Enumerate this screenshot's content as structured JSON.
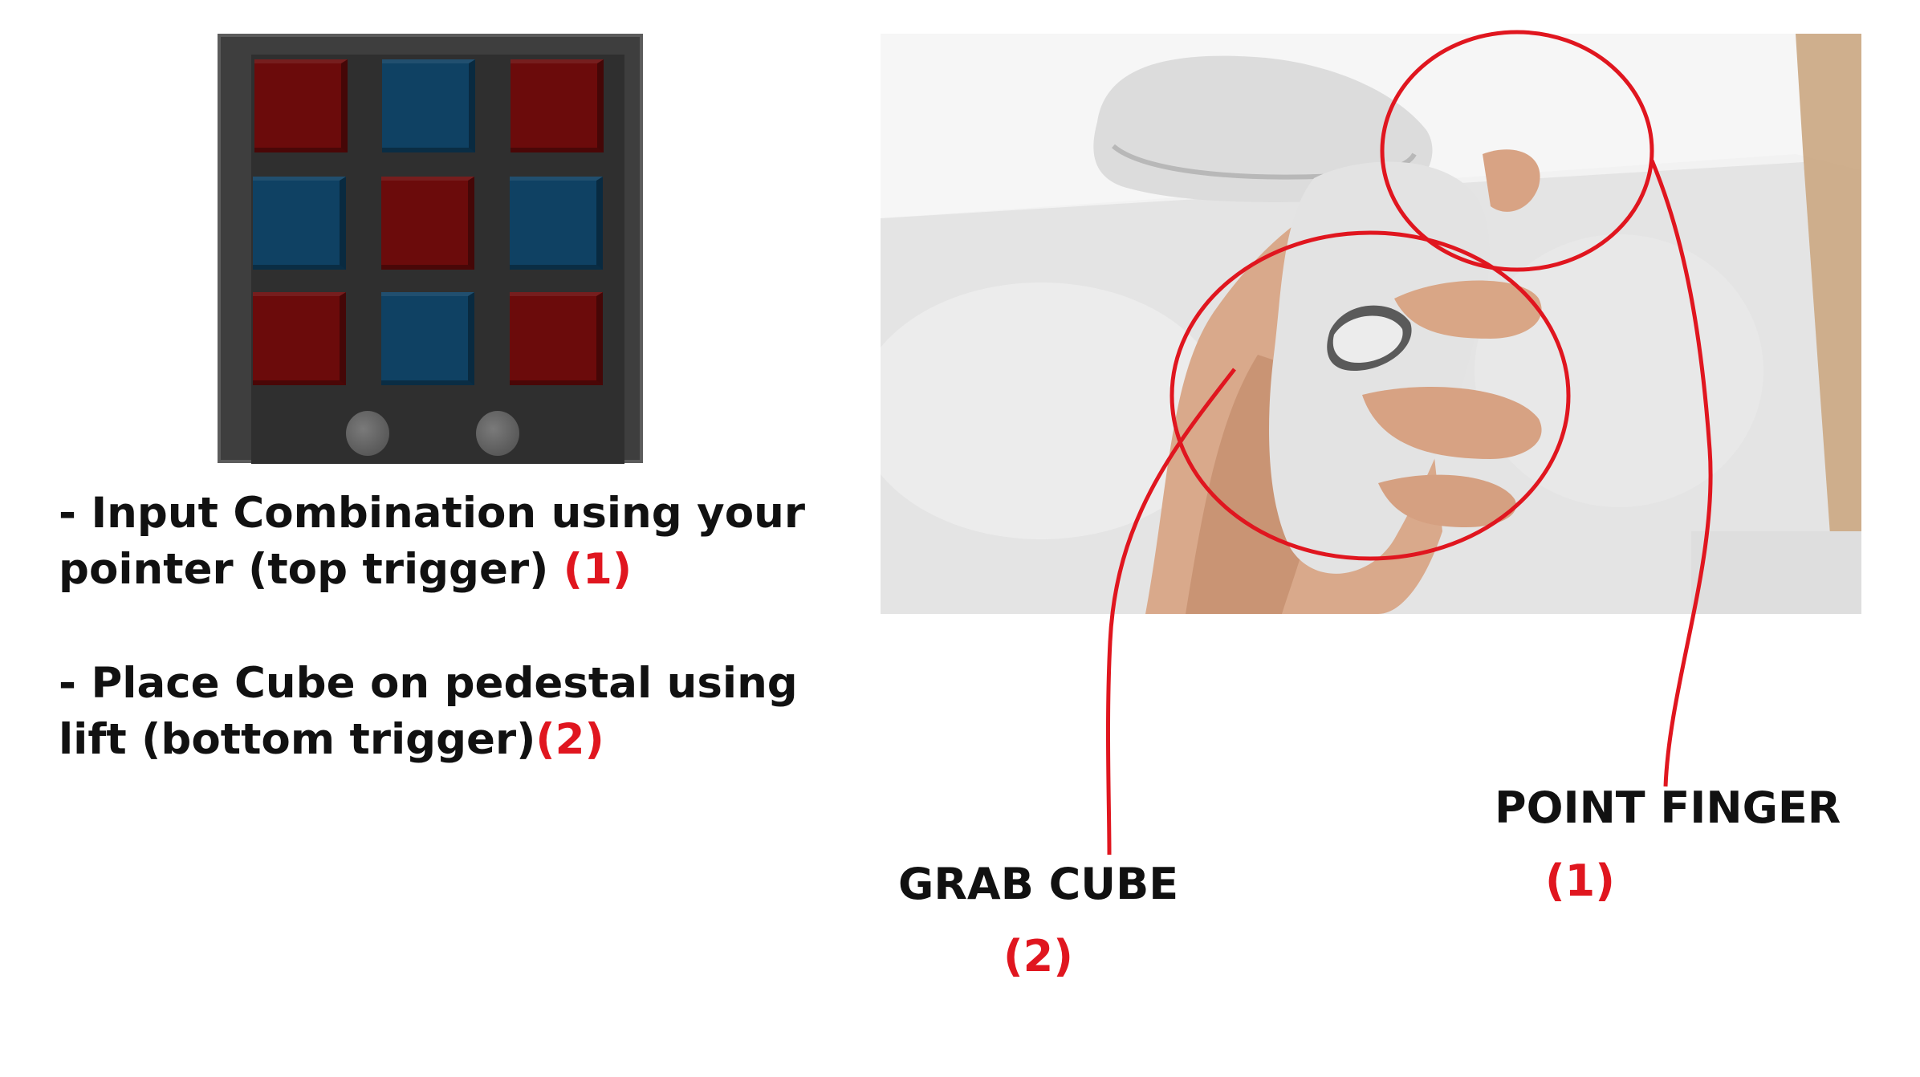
{
  "instructions": [
    {
      "line1": "- Input Combination using your",
      "line2": "pointer (top trigger) ",
      "marker": "(1)"
    },
    {
      "line1": "- Place Cube on pedestal using",
      "line2": "lift (bottom trigger)",
      "marker": "(2)"
    }
  ],
  "callouts": {
    "grab": {
      "label": "GRAB CUBE",
      "number": "(2)"
    },
    "point": {
      "label": "POINT FINGER",
      "number": "(1)"
    }
  },
  "board": {
    "grid": [
      [
        "red",
        "blue",
        "red"
      ],
      [
        "blue",
        "red",
        "blue"
      ],
      [
        "red",
        "blue",
        "red"
      ]
    ],
    "pedestal_count": 2
  },
  "colors": {
    "annotation_red": "#e0161f",
    "cube_red": "#6b0b0b",
    "cube_blue": "#0f4163",
    "board_gray": "#3e3e3e"
  }
}
